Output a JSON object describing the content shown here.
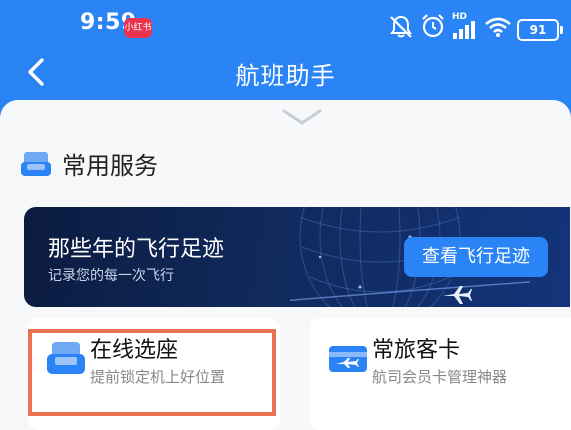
{
  "status_bar": {
    "time": "9:59",
    "app_badge": "小红书",
    "network_label": "HD",
    "battery": "91"
  },
  "nav": {
    "title": "航班助手"
  },
  "section": {
    "title": "常用服务"
  },
  "banner": {
    "title": "那些年的飞行足迹",
    "subtitle": "记录您的每一次飞行",
    "button_label": "查看飞行足迹"
  },
  "cards": {
    "seat": {
      "title": "在线选座",
      "subtitle": "提前锁定机上好位置"
    },
    "frequent_flyer": {
      "title": "常旅客卡",
      "subtitle": "航司会员卡管理神器"
    }
  },
  "colors": {
    "brand_blue": "#2b84f5",
    "banner_dark": "#0b1b3f",
    "highlight": "#e8734f"
  }
}
